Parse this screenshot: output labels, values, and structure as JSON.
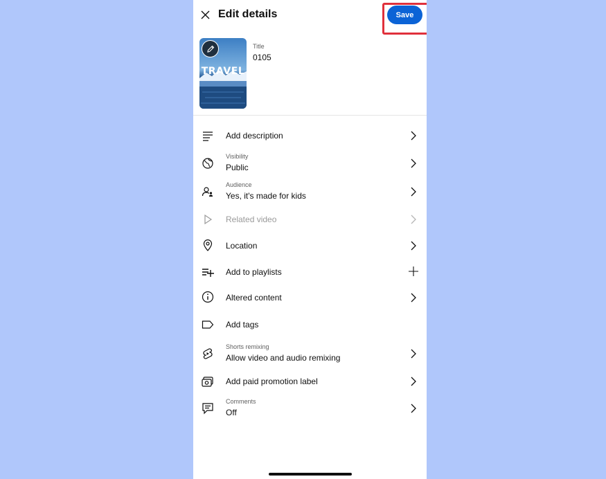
{
  "header": {
    "title": "Edit details",
    "save_label": "Save"
  },
  "thumbnail": {
    "overlay_text": "TRAVEL",
    "edit_icon": "pencil-icon"
  },
  "title_field": {
    "label": "Title",
    "value": "0105"
  },
  "rows": [
    {
      "label": "Add description",
      "icon": "description-icon",
      "trailing": "chevron"
    },
    {
      "sublabel": "Visibility",
      "value": "Public",
      "icon": "globe-icon",
      "trailing": "chevron"
    },
    {
      "sublabel": "Audience",
      "value": "Yes, it's made for kids",
      "icon": "audience-icon",
      "trailing": "chevron"
    },
    {
      "label": "Related video",
      "icon": "play-icon",
      "trailing": "chevron",
      "disabled": true
    },
    {
      "label": "Location",
      "icon": "location-pin-icon",
      "trailing": "chevron"
    },
    {
      "label": "Add to playlists",
      "icon": "playlist-add-icon",
      "trailing": "plus"
    },
    {
      "label": "Altered content",
      "icon": "info-icon",
      "trailing": "chevron"
    },
    {
      "label": "Add tags",
      "icon": "tag-icon",
      "trailing": "none"
    },
    {
      "sublabel": "Shorts remixing",
      "value": "Allow video and audio remixing",
      "icon": "shorts-remix-icon",
      "trailing": "chevron"
    },
    {
      "label": "Add paid promotion label",
      "icon": "paid-promotion-icon",
      "trailing": "chevron"
    },
    {
      "sublabel": "Comments",
      "value": "Off",
      "icon": "comments-icon",
      "trailing": "chevron"
    }
  ],
  "colors": {
    "background": "#b0c7fb",
    "accent": "#0b63d6",
    "highlight": "#e0303b"
  }
}
